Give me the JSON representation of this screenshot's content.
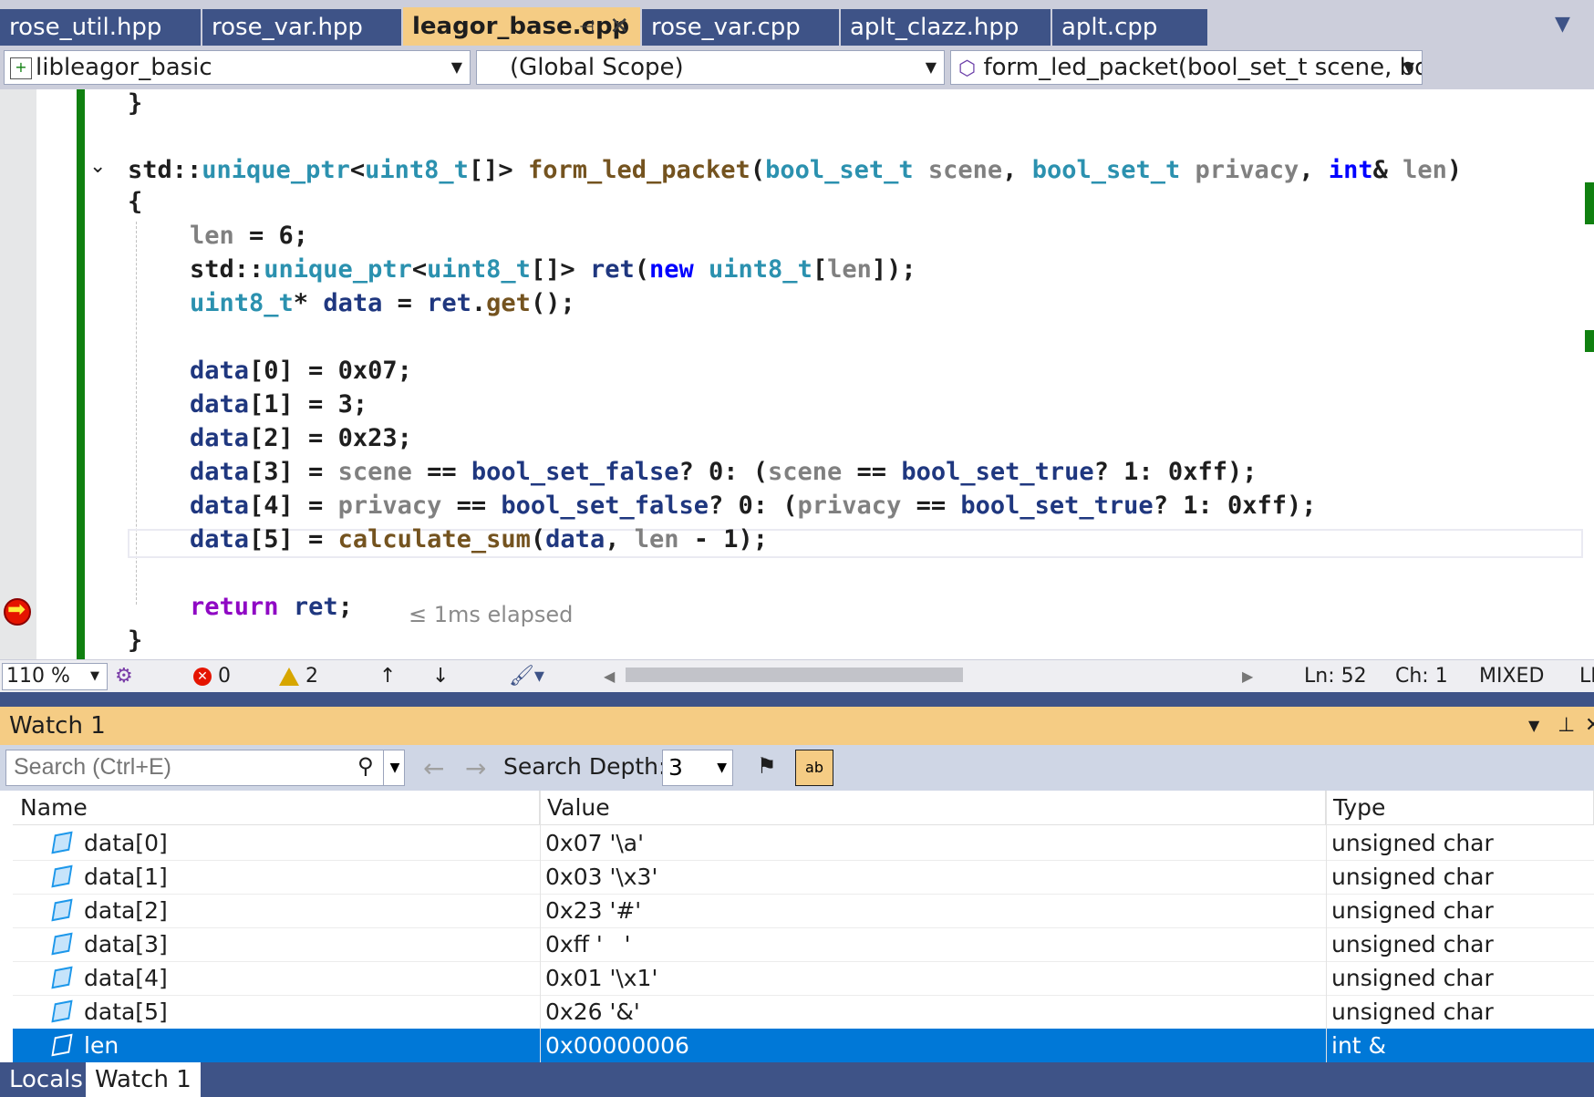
{
  "tabs": [
    {
      "label": "rose_util.hpp"
    },
    {
      "label": "rose_var.hpp"
    },
    {
      "label": "leagor_base.cpp"
    },
    {
      "label": "rose_var.cpp"
    },
    {
      "label": "aplt_clazz.hpp"
    },
    {
      "label": "aplt.cpp"
    }
  ],
  "active_tab_index": 2,
  "nav": {
    "project": "libleagor_basic",
    "scope": "(Global Scope)",
    "member": "form_led_packet(bool_set_t scene, bool_set_"
  },
  "code": {
    "line_close_prev": "}",
    "signature": {
      "ns": "std::",
      "type1": "unique_ptr",
      "lt": "<",
      "type2": "uint8_t",
      "arr": "[]>",
      "fn": "form_led_packet",
      "p1_type": "bool_set_t",
      "p1_name": "scene",
      "p2_type": "bool_set_t",
      "p2_name": "privacy",
      "p3_kw": "int",
      "p3_rest": "&",
      "p3_name": "len"
    },
    "open_brace": "{",
    "close_brace": "}",
    "elapsed": "≤ 1ms elapsed"
  },
  "status": {
    "zoom": "110 %",
    "errors": "0",
    "warnings": "2",
    "line": "Ln: 52",
    "col": "Ch: 1",
    "eol": "MIXED",
    "encoding": "LF"
  },
  "watch": {
    "title": "Watch 1",
    "search_placeholder": "Search (Ctrl+E)",
    "search_depth_label": "Search Depth:",
    "search_depth": "3",
    "columns": {
      "name": "Name",
      "value": "Value",
      "type": "Type"
    },
    "rows": [
      {
        "name": "data[0]",
        "value": "0x07 '\\a'",
        "type": "unsigned char"
      },
      {
        "name": "data[1]",
        "value": "0x03 '\\x3'",
        "type": "unsigned char"
      },
      {
        "name": "data[2]",
        "value": "0x23 '#'",
        "type": "unsigned char"
      },
      {
        "name": "data[3]",
        "value": "0xff '   '",
        "type": "unsigned char"
      },
      {
        "name": "data[4]",
        "value": "0x01 '\\x1'",
        "type": "unsigned char"
      },
      {
        "name": "data[5]",
        "value": "0x26 '&'",
        "type": "unsigned char"
      },
      {
        "name": "len",
        "value": "0x00000006",
        "type": "int &"
      }
    ],
    "selected_row": 6
  },
  "bottom_tabs": [
    {
      "label": "Locals"
    },
    {
      "label": "Watch 1"
    }
  ],
  "colors": {
    "tab_bg": "#3e5387",
    "active_tab": "#f5cc84",
    "selection": "#0078d7",
    "keyword": "#0000ff",
    "type": "#2b91af"
  }
}
